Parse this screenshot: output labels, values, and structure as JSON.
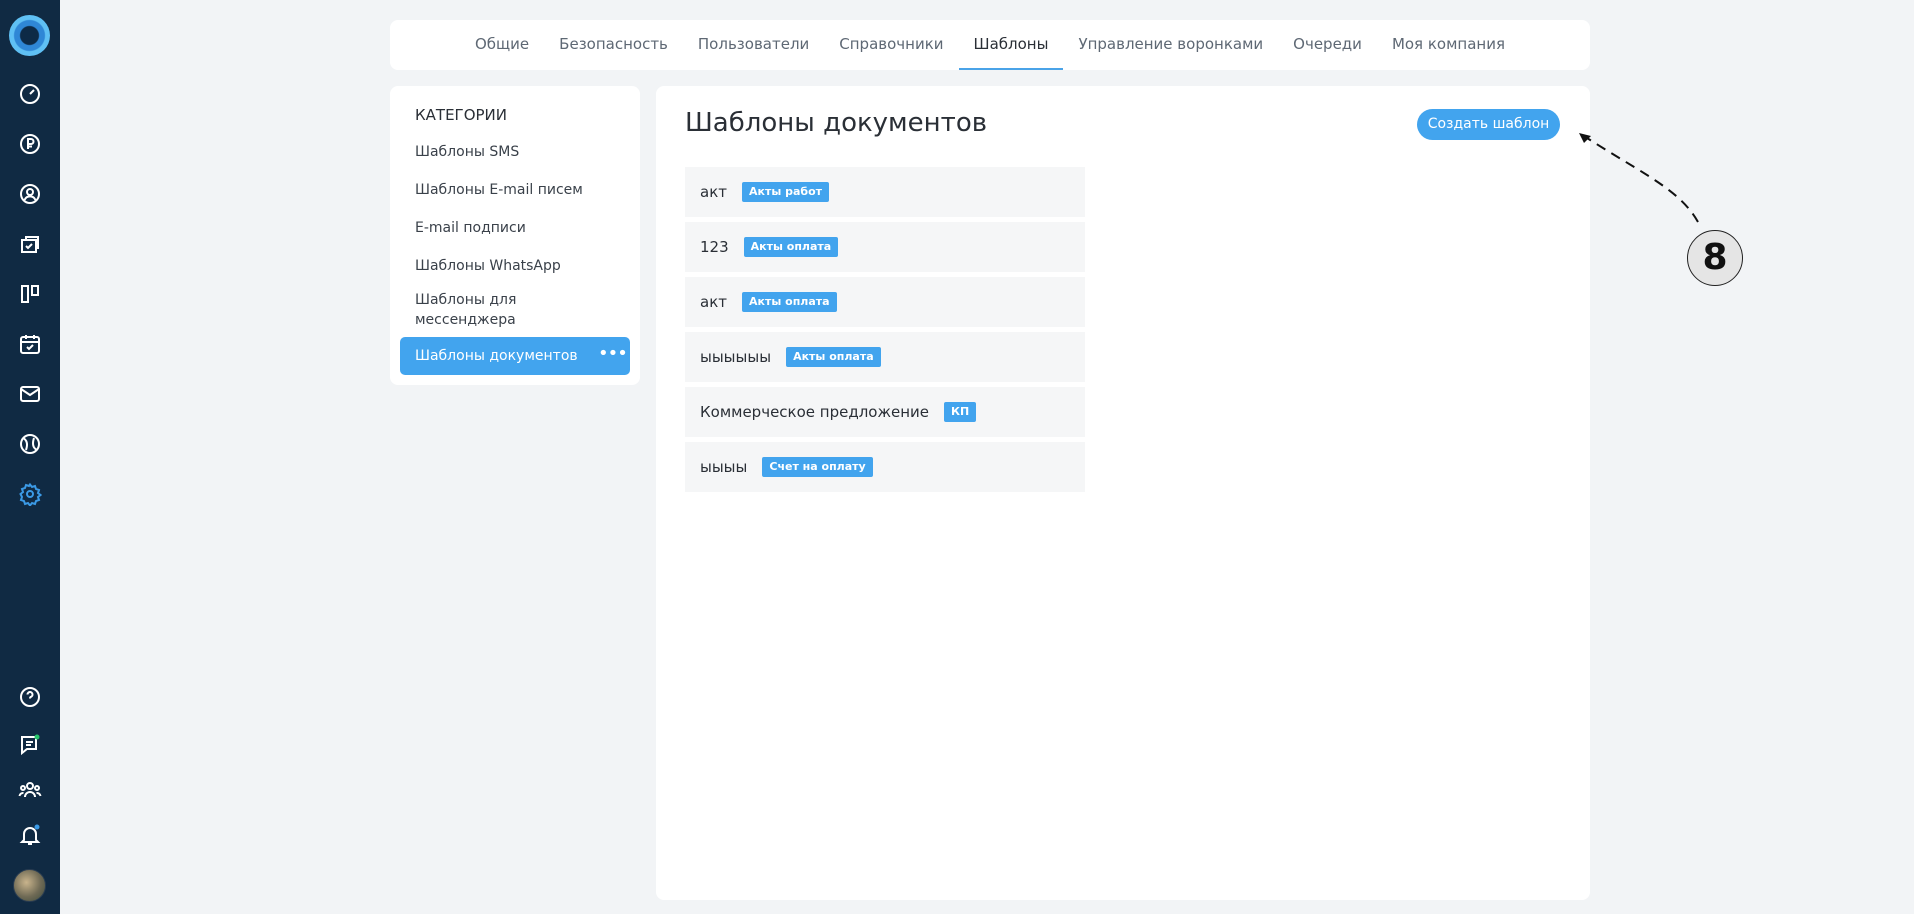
{
  "top_tabs": [
    {
      "label": "Общие"
    },
    {
      "label": "Безопасность"
    },
    {
      "label": "Пользователи"
    },
    {
      "label": "Справочники"
    },
    {
      "label": "Шаблоны",
      "active": true
    },
    {
      "label": "Управление воронками"
    },
    {
      "label": "Очереди"
    },
    {
      "label": "Моя компания"
    }
  ],
  "categories": {
    "title": "КАТЕГОРИИ",
    "items": [
      "Шаблоны SMS",
      "Шаблоны E-mail писем",
      "E-mail подписи",
      "Шаблоны WhatsApp",
      "Шаблоны для мессенджера"
    ],
    "active": "Шаблоны документов"
  },
  "main": {
    "title": "Шаблоны документов",
    "create_button": "Создать шаблон",
    "templates": [
      {
        "name": "акт",
        "badge": "Акты работ"
      },
      {
        "name": "123",
        "badge": "Акты оплата"
      },
      {
        "name": "акт",
        "badge": "Акты оплата"
      },
      {
        "name": "ыыыыыы",
        "badge": "Акты оплата"
      },
      {
        "name": "Коммерческое предложение",
        "badge": "КП"
      },
      {
        "name": "ыыыы",
        "badge": "Счет на оплату"
      }
    ]
  },
  "annotation": {
    "number": "8"
  },
  "sidebar_icons": [
    "dashboard-icon",
    "ruble-icon",
    "contacts-icon",
    "deals-icon",
    "kanban-icon",
    "calendar-icon",
    "mail-icon",
    "globe-icon",
    "settings-icon",
    "help-icon",
    "chat-icon",
    "team-icon",
    "bell-icon"
  ],
  "colors": {
    "sidebar": "#102a43",
    "accent": "#42a4ee",
    "active_icon": "#3b9ae6"
  }
}
